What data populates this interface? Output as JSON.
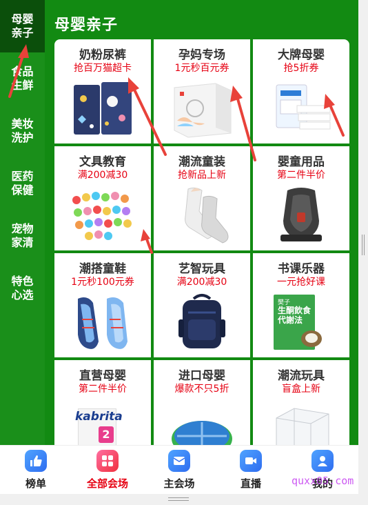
{
  "sidebar": {
    "items": [
      {
        "label": "母婴亲子",
        "active": true
      },
      {
        "label": "食品生鲜"
      },
      {
        "label": "美妆洗护"
      },
      {
        "label": "医药保健"
      },
      {
        "label": "宠物家清"
      },
      {
        "label": "特色心选"
      }
    ]
  },
  "section": {
    "title": "母婴亲子"
  },
  "cards": [
    {
      "title": "奶粉尿裤",
      "sub": "抢百万猫超卡"
    },
    {
      "title": "孕妈专场",
      "sub": "1元秒百元券"
    },
    {
      "title": "大牌母婴",
      "sub": "抢5折券"
    },
    {
      "title": "文具教育",
      "sub": "满200减30"
    },
    {
      "title": "潮流童装",
      "sub": "抢新品上新"
    },
    {
      "title": "婴童用品",
      "sub": "第二件半价"
    },
    {
      "title": "潮搭童鞋",
      "sub": "1元秒100元券"
    },
    {
      "title": "艺智玩具",
      "sub": "满200减30"
    },
    {
      "title": "书课乐器",
      "sub": "一元抢好课"
    },
    {
      "title": "直营母婴",
      "sub": "第二件半价"
    },
    {
      "title": "进口母婴",
      "sub": "爆款不只5折"
    },
    {
      "title": "潮流玩具",
      "sub": "盲盒上新"
    }
  ],
  "product_text": {
    "book_brand": "樊子",
    "book_title": "生酮飲食代謝法",
    "formula_brand": "kabrita"
  },
  "tabbar": {
    "tabs": [
      {
        "label": "榜单"
      },
      {
        "label": "全部会场",
        "active": true
      },
      {
        "label": "主会场"
      },
      {
        "label": "直播"
      },
      {
        "label": "我的"
      }
    ]
  },
  "watermark": "quxx05.com",
  "colors": {
    "primary_green": "#128a12",
    "sidebar_green": "#1a8f1a",
    "active_dark_green": "#0b4f0b",
    "promo_red": "#e60012",
    "arrow_red": "#e8423a"
  }
}
